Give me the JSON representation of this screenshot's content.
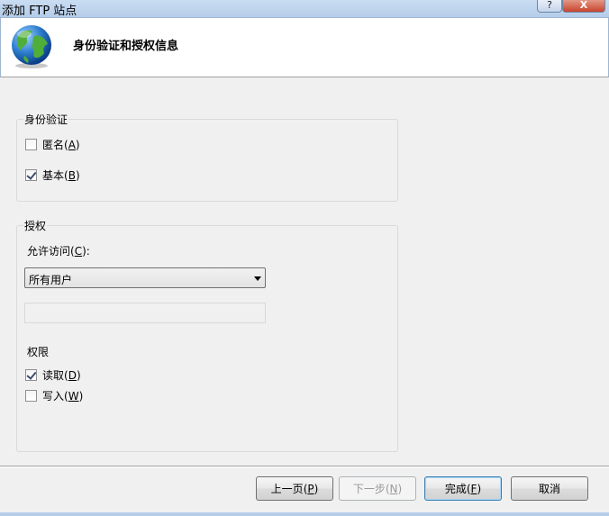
{
  "window": {
    "title": "添加 FTP 站点",
    "help_label": "?",
    "close_label": "X"
  },
  "header": {
    "title": "身份验证和授权信息",
    "icon": "globe-icon"
  },
  "authentication": {
    "legend": "身份验证",
    "anonymous": {
      "label": "匿名",
      "mnemonic_open": "(",
      "mnemonic": "A",
      "mnemonic_close": ")",
      "checked": false
    },
    "basic": {
      "label": "基本",
      "mnemonic_open": "(",
      "mnemonic": "B",
      "mnemonic_close": ")",
      "checked": true
    }
  },
  "authorization": {
    "legend": "授权",
    "allow_access_label": "允许访问",
    "allow_access_mnemonic": "C",
    "allow_access_suffix": "):",
    "allow_access_selected": "所有用户",
    "permissions_label": "权限",
    "read": {
      "label": "读取",
      "mnemonic": "D",
      "checked": true
    },
    "write": {
      "label": "写入",
      "mnemonic": "W",
      "checked": false
    }
  },
  "buttons": {
    "prev": {
      "label": "上一页",
      "mnemonic": "P"
    },
    "next": {
      "label": "下一步",
      "mnemonic": "N",
      "disabled": true
    },
    "finish": {
      "label": "完成",
      "mnemonic": "F"
    },
    "cancel": {
      "label": "取消"
    }
  },
  "colors": {
    "titlebar": "#b6cde9",
    "dialog_bg": "#f0f0f0",
    "header_bg": "#ffffff",
    "primary_border": "#3c7fb1"
  }
}
